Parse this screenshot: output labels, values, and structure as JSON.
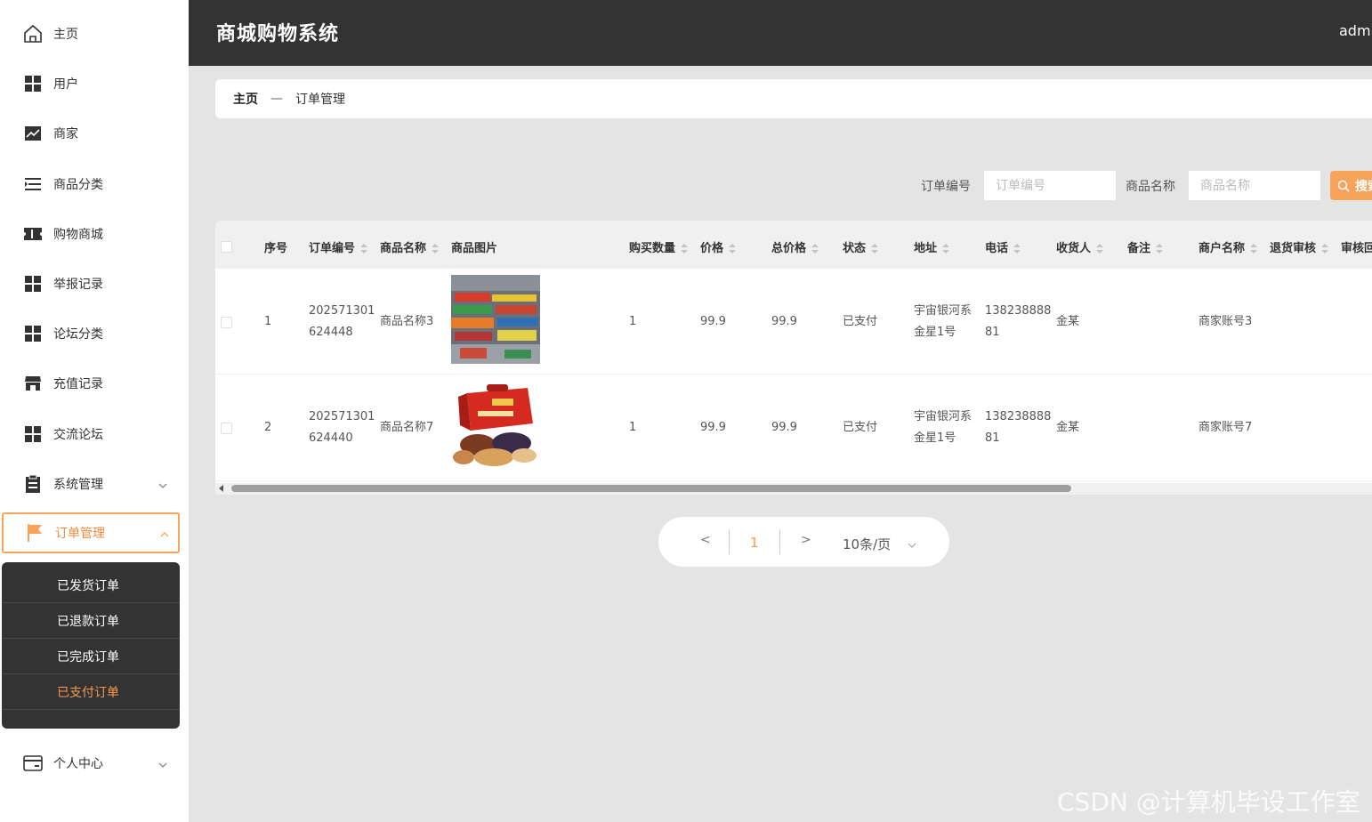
{
  "app": {
    "title": "商城购物系统",
    "user": "admin"
  },
  "sidebar": {
    "items": [
      {
        "label": "主页",
        "icon": "home-icon"
      },
      {
        "label": "用户",
        "icon": "grid-icon"
      },
      {
        "label": "商家",
        "icon": "chart-icon"
      },
      {
        "label": "商品分类",
        "icon": "list-icon"
      },
      {
        "label": "购物商城",
        "icon": "ticket-icon"
      },
      {
        "label": "举报记录",
        "icon": "grid-icon"
      },
      {
        "label": "论坛分类",
        "icon": "grid-icon"
      },
      {
        "label": "充值记录",
        "icon": "shop-icon"
      },
      {
        "label": "交流论坛",
        "icon": "grid-icon"
      },
      {
        "label": "系统管理",
        "icon": "clipboard-icon"
      },
      {
        "label": "订单管理",
        "icon": "flag-icon"
      },
      {
        "label": "个人中心",
        "icon": "card-icon"
      }
    ],
    "order_submenu": [
      "已发货订单",
      "已退款订单",
      "已完成订单",
      "已支付订单"
    ]
  },
  "breadcrumb": {
    "home": "主页",
    "separator": "—",
    "current": "订单管理"
  },
  "search": {
    "order_no_label": "订单编号",
    "order_no_placeholder": "订单编号",
    "product_label": "商品名称",
    "product_placeholder": "商品名称",
    "button": "搜索"
  },
  "table": {
    "headers": [
      "序号",
      "订单编号",
      "商品名称",
      "商品图片",
      "购买数量",
      "价格",
      "总价格",
      "状态",
      "地址",
      "电话",
      "收货人",
      "备注",
      "商户名称",
      "退货审核",
      "审核回复"
    ],
    "rows": [
      {
        "index": "1",
        "order_no_1": "202571301",
        "order_no_2": "624448",
        "product": "商品名称3",
        "qty": "1",
        "price": "99.9",
        "total": "99.9",
        "status": "已支付",
        "addr_1": "宇宙银河系",
        "addr_2": "金星1号",
        "phone_1": "138238888",
        "phone_2": "81",
        "receiver": "金某",
        "note": "",
        "merchant": "商家账号3"
      },
      {
        "index": "2",
        "order_no_1": "202571301",
        "order_no_2": "624440",
        "product": "商品名称7",
        "qty": "1",
        "price": "99.9",
        "total": "99.9",
        "status": "已支付",
        "addr_1": "宇宙银河系",
        "addr_2": "金星1号",
        "phone_1": "138238888",
        "phone_2": "81",
        "receiver": "金某",
        "note": "",
        "merchant": "商家账号7"
      }
    ]
  },
  "pagination": {
    "prev": "<",
    "page": "1",
    "next": ">",
    "page_size": "10条/页"
  },
  "watermark": "CSDN @计算机毕设工作室",
  "colors": {
    "accent": "#f7a35c",
    "header_bg": "#333333",
    "page_bg": "#e4e4e4"
  }
}
